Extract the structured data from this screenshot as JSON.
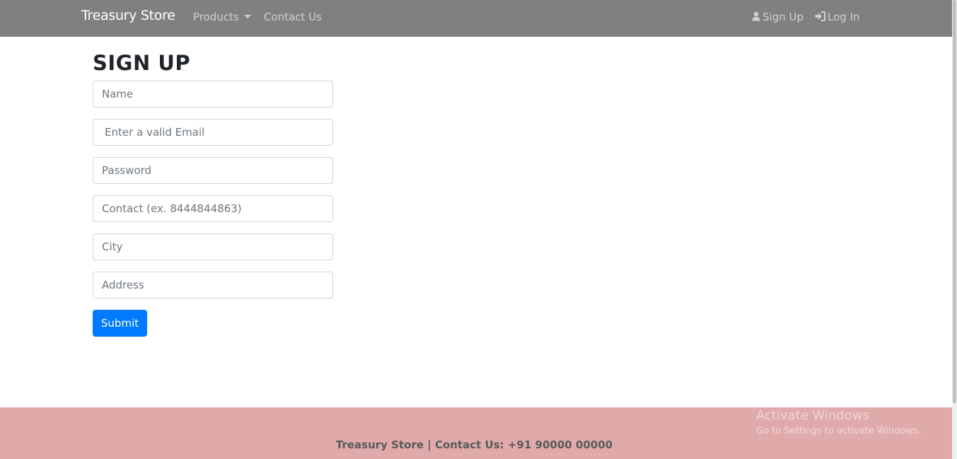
{
  "navbar": {
    "brand": "Treasury Store",
    "products_label": "Products",
    "contact_label": "Contact Us",
    "signup_label": "Sign Up",
    "login_label": "Log In",
    "signup_icon": "user-icon",
    "login_icon": "sign-in-icon"
  },
  "form": {
    "title": "SIGN UP",
    "name_placeholder": "Name",
    "email_placeholder": "Enter a valid Email",
    "password_placeholder": "Password",
    "contact_placeholder": "Contact (ex. 8444844863)",
    "city_placeholder": "City",
    "address_placeholder": "Address",
    "submit_label": "Submit"
  },
  "footer": {
    "text": "Treasury Store | Contact Us: +91 90000 00000"
  },
  "watermark": {
    "title": "Activate Windows",
    "subtitle": "Go to Settings to activate Windows."
  },
  "colors": {
    "navbar_bg": "#808080",
    "footer_bg": "#e0aaaa",
    "primary": "#007bff"
  }
}
